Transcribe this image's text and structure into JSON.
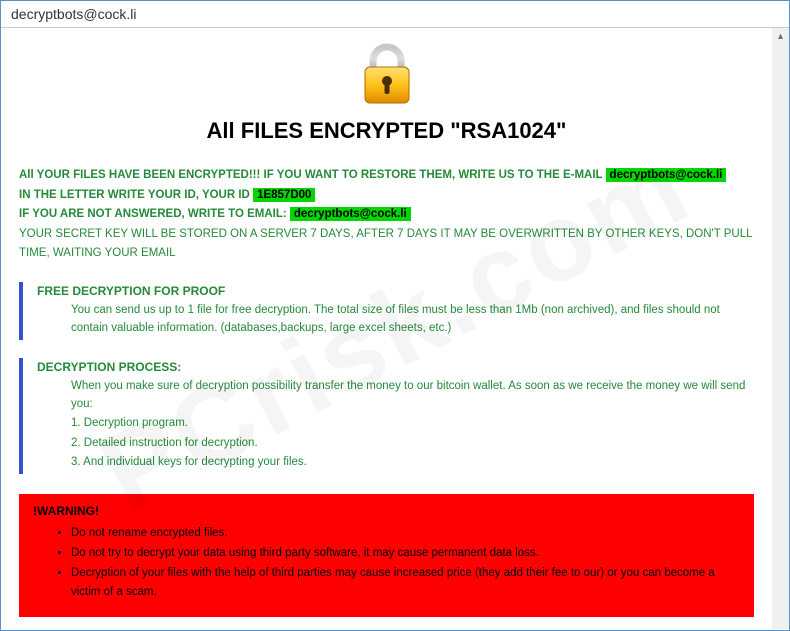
{
  "window": {
    "title": "decryptbots@cock.li"
  },
  "header": {
    "title": "All FILES ENCRYPTED \"RSA1024\""
  },
  "intro": {
    "l1a": "All YOUR FILES HAVE BEEN ENCRYPTED!!! IF YOU WANT TO RESTORE THEM, WRITE US TO THE E-MAIL ",
    "l1hl": "decryptbots@cock.li",
    "l2a": "IN THE LETTER WRITE YOUR ID, YOUR ID ",
    "l2hl": "1E857D00",
    "l3a": "IF YOU ARE NOT ANSWERED, WRITE TO EMAIL: ",
    "l3hl": "decryptbots@cock.li",
    "l4": "YOUR SECRET KEY WILL BE STORED ON A SERVER 7 DAYS, AFTER 7 DAYS IT MAY BE OVERWRITTEN BY OTHER KEYS, DON'T PULL TIME, WAITING YOUR EMAIL"
  },
  "free": {
    "title": "FREE DECRYPTION FOR PROOF",
    "body": "You can send us up to 1 file for free decryption. The total size of files must be less than 1Mb (non archived), and files should not contain valuable information. (databases,backups, large excel sheets, etc.)"
  },
  "process": {
    "title": "DECRYPTION PROCESS:",
    "l0": "When you make sure of decryption possibility transfer the money to our bitcoin wallet. As soon as we receive the money we will send you:",
    "l1": "1. Decryption program.",
    "l2": "2. Detailed instruction for decryption.",
    "l3": "3. And individual keys for decrypting your files."
  },
  "warning": {
    "title": "!WARNING!",
    "i1": "Do not rename encrypted files.",
    "i2": "Do not try to decrypt your data using third party software, it may cause permanent data loss.",
    "i3": "Decryption of your files with the help of third parties may cause increased price (they add their fee to our) or you can become a victim of a scam."
  },
  "watermark": "PCrisk.com"
}
